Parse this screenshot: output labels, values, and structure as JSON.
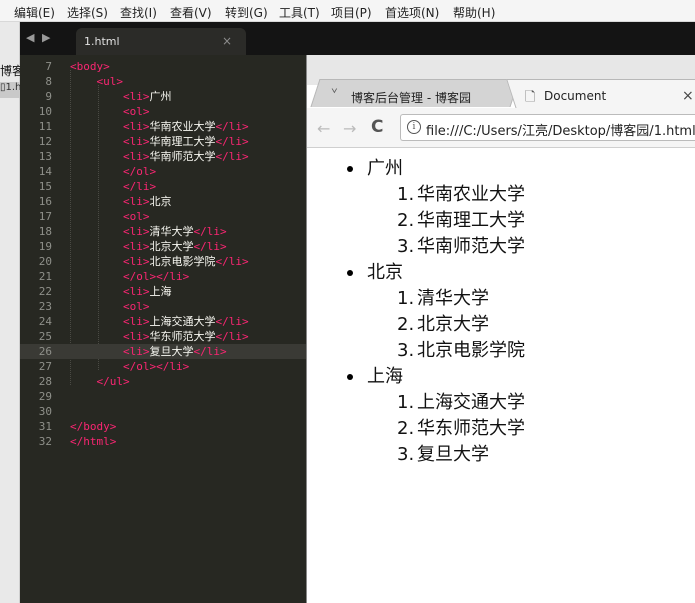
{
  "menu": [
    "编辑(E)",
    "选择(S)",
    "查找(I)",
    "查看(V)",
    "转到(G)",
    "工具(T)",
    "项目(P)",
    "首选项(N)",
    "帮助(H)"
  ],
  "sidebar": {
    "folder_label": "博客",
    "file_label": "1.h"
  },
  "editor": {
    "nav_arrows": "◀ ▶",
    "tab_label": "1.html",
    "tab_close": "×",
    "lines": [
      {
        "n": "7",
        "segs": [
          [
            "tag",
            "<body>"
          ]
        ]
      },
      {
        "n": "8",
        "segs": [
          [
            "pun",
            "    "
          ],
          [
            "tag",
            "<ul>"
          ]
        ]
      },
      {
        "n": "9",
        "segs": [
          [
            "pun",
            "        "
          ],
          [
            "tag",
            "<li>"
          ],
          [
            "txt",
            "广州"
          ]
        ]
      },
      {
        "n": "10",
        "segs": [
          [
            "pun",
            "        "
          ],
          [
            "tag",
            "<ol>"
          ]
        ]
      },
      {
        "n": "11",
        "segs": [
          [
            "pun",
            "        "
          ],
          [
            "tag",
            "<li>"
          ],
          [
            "txt",
            "华南农业大学"
          ],
          [
            "tag",
            "</li>"
          ]
        ]
      },
      {
        "n": "12",
        "segs": [
          [
            "pun",
            "        "
          ],
          [
            "tag",
            "<li>"
          ],
          [
            "txt",
            "华南理工大学"
          ],
          [
            "tag",
            "</li>"
          ]
        ]
      },
      {
        "n": "13",
        "segs": [
          [
            "pun",
            "        "
          ],
          [
            "tag",
            "<li>"
          ],
          [
            "txt",
            "华南师范大学"
          ],
          [
            "tag",
            "</li>"
          ]
        ]
      },
      {
        "n": "14",
        "segs": [
          [
            "pun",
            "        "
          ],
          [
            "tag",
            "</ol>"
          ]
        ]
      },
      {
        "n": "15",
        "segs": [
          [
            "pun",
            "        "
          ],
          [
            "tag",
            "</li>"
          ]
        ]
      },
      {
        "n": "16",
        "segs": [
          [
            "pun",
            "        "
          ],
          [
            "tag",
            "<li>"
          ],
          [
            "txt",
            "北京"
          ]
        ]
      },
      {
        "n": "17",
        "segs": [
          [
            "pun",
            "        "
          ],
          [
            "tag",
            "<ol>"
          ]
        ]
      },
      {
        "n": "18",
        "segs": [
          [
            "pun",
            "        "
          ],
          [
            "tag",
            "<li>"
          ],
          [
            "txt",
            "清华大学"
          ],
          [
            "tag",
            "</li>"
          ]
        ]
      },
      {
        "n": "19",
        "segs": [
          [
            "pun",
            "        "
          ],
          [
            "tag",
            "<li>"
          ],
          [
            "txt",
            "北京大学"
          ],
          [
            "tag",
            "</li>"
          ]
        ]
      },
      {
        "n": "20",
        "segs": [
          [
            "pun",
            "        "
          ],
          [
            "tag",
            "<li>"
          ],
          [
            "txt",
            "北京电影学院"
          ],
          [
            "tag",
            "</li>"
          ]
        ]
      },
      {
        "n": "21",
        "segs": [
          [
            "pun",
            "        "
          ],
          [
            "tag",
            "</ol></li>"
          ]
        ]
      },
      {
        "n": "22",
        "segs": [
          [
            "pun",
            "        "
          ],
          [
            "tag",
            "<li>"
          ],
          [
            "txt",
            "上海"
          ]
        ]
      },
      {
        "n": "23",
        "segs": [
          [
            "pun",
            "        "
          ],
          [
            "tag",
            "<ol>"
          ]
        ]
      },
      {
        "n": "24",
        "segs": [
          [
            "pun",
            "        "
          ],
          [
            "tag",
            "<li>"
          ],
          [
            "txt",
            "上海交通大学"
          ],
          [
            "tag",
            "</li>"
          ]
        ]
      },
      {
        "n": "25",
        "segs": [
          [
            "pun",
            "        "
          ],
          [
            "tag",
            "<li>"
          ],
          [
            "txt",
            "华东师范大学"
          ],
          [
            "tag",
            "</li>"
          ]
        ]
      },
      {
        "n": "26",
        "segs": [
          [
            "pun",
            "        "
          ],
          [
            "tag",
            "<li>"
          ],
          [
            "txt",
            "复旦大学"
          ],
          [
            "tag",
            "</li>"
          ]
        ],
        "current": true
      },
      {
        "n": "27",
        "segs": [
          [
            "pun",
            "        "
          ],
          [
            "tag",
            "</ol></li>"
          ]
        ]
      },
      {
        "n": "28",
        "segs": [
          [
            "pun",
            "    "
          ],
          [
            "tag",
            "</ul>"
          ]
        ]
      },
      {
        "n": "29",
        "segs": []
      },
      {
        "n": "30",
        "segs": []
      },
      {
        "n": "31",
        "segs": [
          [
            "tag",
            "</body>"
          ]
        ]
      },
      {
        "n": "32",
        "segs": [
          [
            "tag",
            "</html>"
          ]
        ]
      }
    ]
  },
  "browser": {
    "tabs": [
      {
        "title": "博客后台管理 - 博客园",
        "icon": "cnblogs-icon",
        "active": false
      },
      {
        "title": "Document",
        "icon": "page-icon",
        "active": true,
        "close": "×"
      }
    ],
    "back": "←",
    "forward": "→",
    "reload": "C",
    "info": "i",
    "url": "file:///C:/Users/江亮/Desktop/博客园/1.html"
  },
  "page": {
    "groups": [
      {
        "city": "广州",
        "items": [
          "华南农业大学",
          "华南理工大学",
          "华南师范大学"
        ]
      },
      {
        "city": "北京",
        "items": [
          "清华大学",
          "北京大学",
          "北京电影学院"
        ]
      },
      {
        "city": "上海",
        "items": [
          "上海交通大学",
          "华东师范大学",
          "复旦大学"
        ]
      }
    ]
  },
  "colors": {
    "editor_bg": "#272822",
    "tag": "#f92672",
    "text": "#f8f8f2",
    "gutter": "#8f908a"
  }
}
